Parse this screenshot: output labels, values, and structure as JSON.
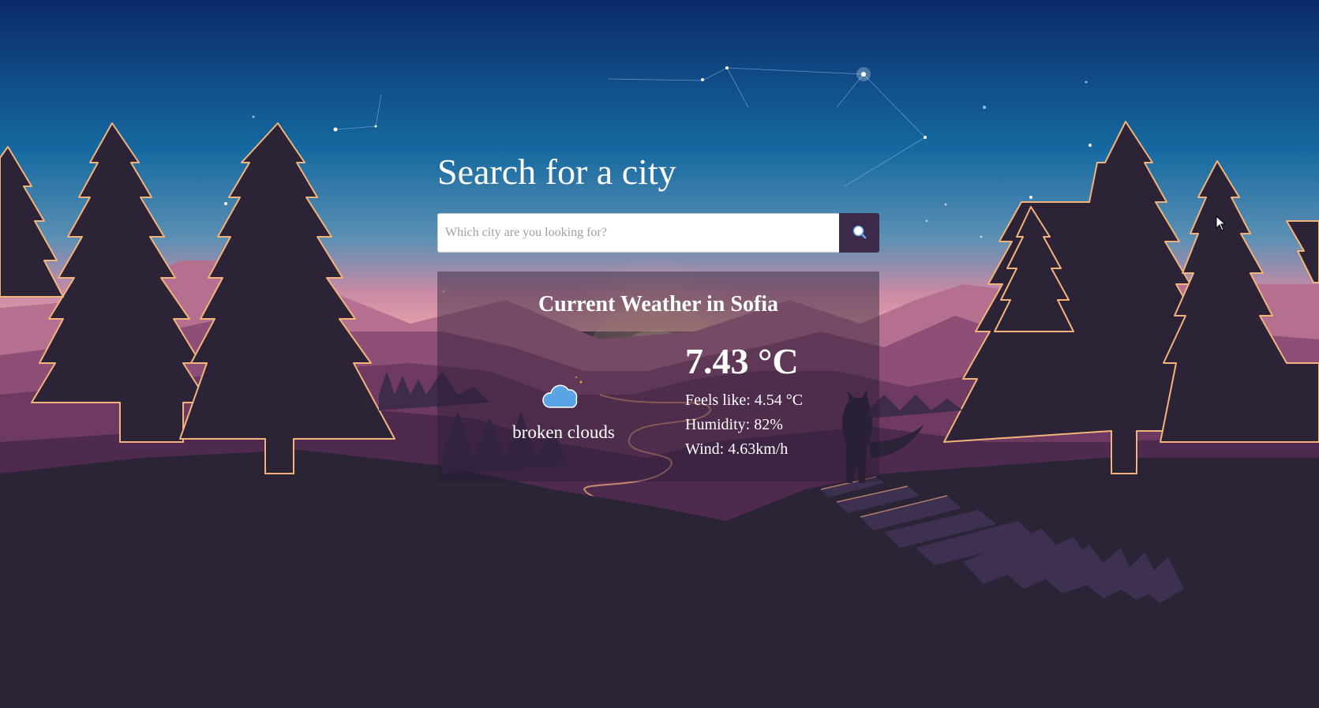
{
  "search": {
    "heading": "Search for a city",
    "placeholder": "Which city are you looking for?",
    "value": "",
    "button_icon": "search-icon"
  },
  "weather": {
    "heading": "Current Weather in Sofia",
    "condition_icon": "broken-clouds-night-icon",
    "condition": "broken clouds",
    "temperature": "7.43 °C",
    "feels_like": "Feels like: 4.54 °C",
    "humidity": "Humidity: 82%",
    "wind": "Wind: 4.63km/h"
  },
  "colors": {
    "sky_top": "#0b2a6b",
    "sky_mid": "#155f98",
    "horizon": "#d68ba2",
    "ground": "#2b2437",
    "tree": "#2d2337",
    "tree_edge": "#f3b47c",
    "search_button": "#3b2a4a",
    "cloud": "#5aa4e6",
    "moon": "#f0a020"
  }
}
